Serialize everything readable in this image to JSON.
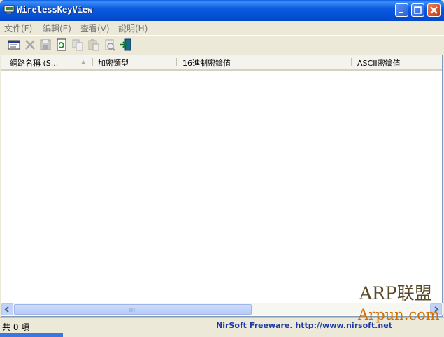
{
  "window": {
    "title": "WirelessKeyView"
  },
  "menu": {
    "items": [
      "文件(F)",
      "編輯(E)",
      "查看(V)",
      "說明(H)"
    ]
  },
  "toolbar": {
    "icons": [
      "html-report-icon",
      "delete-icon",
      "save-icon",
      "refresh-icon",
      "copy-icon",
      "paste-icon",
      "properties-icon",
      "exit-icon"
    ]
  },
  "list": {
    "columns": [
      "網路名稱 (S...",
      "加密類型",
      "16進制密鑰值",
      "ASCII密鑰值"
    ],
    "sorted_column_indicator": "▲"
  },
  "status": {
    "count": "共 0 項",
    "credit": "NirSoft Freeware.  http://www.nirsoft.net"
  },
  "watermark": {
    "line1": "ARP联盟",
    "line2": "Arpun.com"
  },
  "colors": {
    "title_bar": "#0552d6",
    "link": "#1c3aa6",
    "watermark_orange": "#d26f00"
  }
}
